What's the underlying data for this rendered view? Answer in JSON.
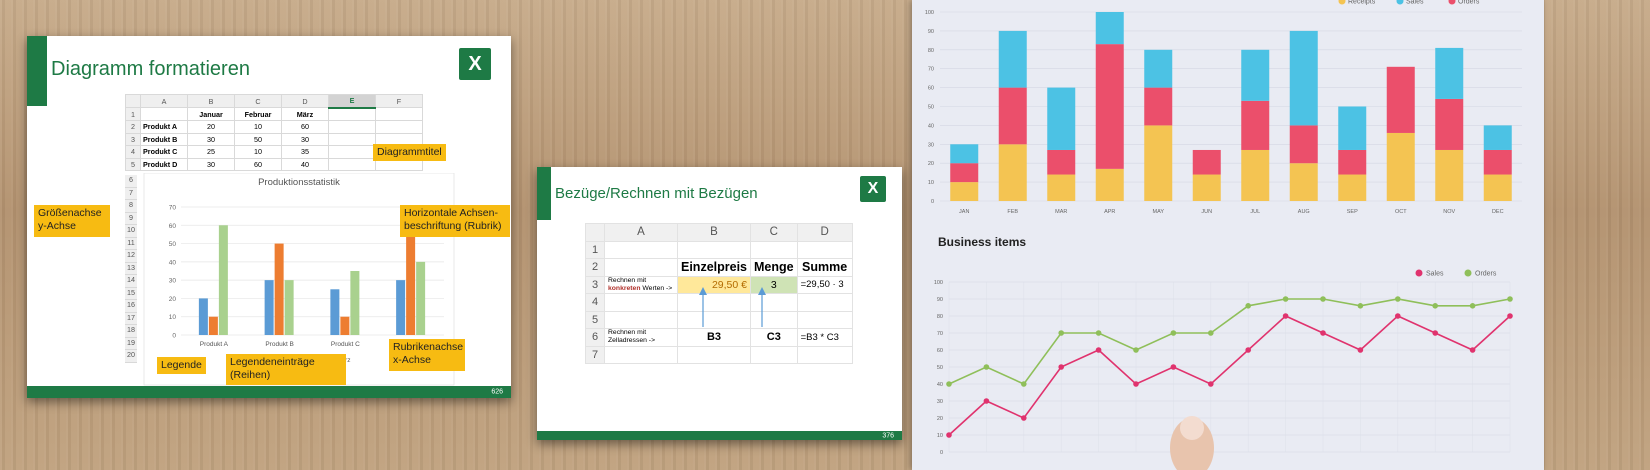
{
  "slide1": {
    "title": "Diagramm formatieren",
    "logo": "X",
    "page": "626",
    "columns": [
      "A",
      "B",
      "C",
      "D",
      "E",
      "F"
    ],
    "header_row": [
      "",
      "Januar",
      "Februar",
      "März",
      "",
      ""
    ],
    "rows": [
      [
        "Produkt A",
        "20",
        "10",
        "60"
      ],
      [
        "Produkt B",
        "30",
        "50",
        "30"
      ],
      [
        "Produkt C",
        "25",
        "10",
        "35"
      ],
      [
        "Produkt D",
        "30",
        "60",
        "40"
      ]
    ],
    "row_numbers": [
      "1",
      "2",
      "3",
      "4",
      "5",
      "6",
      "7",
      "8",
      "9",
      "10",
      "11",
      "12",
      "13",
      "14",
      "15",
      "16",
      "17",
      "18",
      "19",
      "20"
    ],
    "callouts": {
      "diagrammtitel": "Diagrammtitel",
      "groessenachse_1": "Größenachse",
      "groessenachse_2": "y-Achse",
      "horizontale_1": "Horizontale Achsen-",
      "horizontale_2": "beschriftung (Rubrik)",
      "legende": "Legende",
      "legendeneintraege_1": "Legendeneinträge",
      "legendeneintraege_2": "(Reihen)",
      "rubrikenachse_1": "Rubrikenachse",
      "rubrikenachse_2": "x-Achse"
    }
  },
  "slide2": {
    "title": "Bezüge/Rechnen mit Bezügen",
    "logo": "X",
    "page": "376",
    "columns": [
      "A",
      "B",
      "C",
      "D"
    ],
    "row_numbers": [
      "1",
      "2",
      "3",
      "4",
      "5",
      "6",
      "7"
    ],
    "headers": {
      "einzelpreis": "Einzelpreis",
      "menge": "Menge",
      "summe": "Summe"
    },
    "row3": {
      "a_prefix": "Rechnen mit",
      "a_red": "konkreten",
      "a_suffix": "Werten ->",
      "b": "29,50 €",
      "c": "3",
      "d": "=29,50 · 3"
    },
    "row6": {
      "a_1": "Rechnen mit",
      "a_2": "Zelladressen ->",
      "b": "B3",
      "c": "C3",
      "d": "=B3 * C3"
    }
  },
  "colors": {
    "excel_green": "#1e7a45",
    "callout_yellow": "#f7bb12",
    "januar": "#5b9bd5",
    "februar": "#ed7d31",
    "maerz": "#a9d18e",
    "receipts": "#f4c452",
    "sales_bar": "#4cc2e4",
    "orders_bar": "#eb4f6b",
    "sales_line": "#e0336e",
    "orders_line": "#8fbf5a"
  },
  "chart_data": [
    {
      "type": "bar",
      "title": "Produktionsstatistik",
      "categories": [
        "Produkt A",
        "Produkt B",
        "Produkt C",
        "Produkt D"
      ],
      "series": [
        {
          "name": "Januar",
          "values": [
            20,
            30,
            25,
            30
          ]
        },
        {
          "name": "Februar",
          "values": [
            10,
            50,
            10,
            60
          ]
        },
        {
          "name": "März",
          "values": [
            60,
            30,
            35,
            40
          ]
        }
      ],
      "yticks": [
        "0",
        "10",
        "20",
        "30",
        "40",
        "50",
        "60",
        "70"
      ],
      "ylim": [
        0,
        70
      ],
      "legend": "bottom"
    },
    {
      "type": "bar",
      "stacked": true,
      "categories": [
        "JAN",
        "FEB",
        "MAR",
        "APR",
        "MAY",
        "JUN",
        "JUL",
        "AUG",
        "SEP",
        "OCT",
        "NOV",
        "DEC"
      ],
      "series": [
        {
          "name": "Receipts",
          "values": [
            10,
            30,
            14,
            17,
            40,
            14,
            27,
            20,
            14,
            36,
            27,
            14
          ]
        },
        {
          "name": "Orders",
          "values": [
            10,
            30,
            13,
            66,
            20,
            13,
            26,
            20,
            13,
            35,
            27,
            13
          ]
        },
        {
          "name": "Sales",
          "values": [
            10,
            30,
            33,
            17,
            20,
            0,
            27,
            50,
            23,
            0,
            27,
            13
          ]
        }
      ],
      "yticks": [
        "0",
        "10",
        "20",
        "30",
        "40",
        "50",
        "60",
        "70",
        "80",
        "90",
        "100"
      ],
      "ylim": [
        0,
        100
      ],
      "legend": "top-right"
    },
    {
      "type": "line",
      "title": "Business items",
      "x": [
        1,
        2,
        3,
        4,
        5,
        6,
        7,
        8,
        9,
        10,
        11,
        12,
        13,
        14,
        15,
        16
      ],
      "series": [
        {
          "name": "Sales",
          "values": [
            10,
            30,
            20,
            50,
            60,
            40,
            50,
            40,
            60,
            80,
            70,
            60,
            80,
            70,
            60,
            80
          ]
        },
        {
          "name": "Orders",
          "values": [
            40,
            50,
            40,
            70,
            70,
            60,
            70,
            70,
            86,
            90,
            90,
            86,
            90,
            86,
            86,
            90
          ]
        }
      ],
      "yticks": [
        "0",
        "10",
        "20",
        "30",
        "40",
        "50",
        "60",
        "70",
        "80",
        "90",
        "100"
      ],
      "ylim": [
        0,
        100
      ],
      "legend": "top-right"
    }
  ]
}
